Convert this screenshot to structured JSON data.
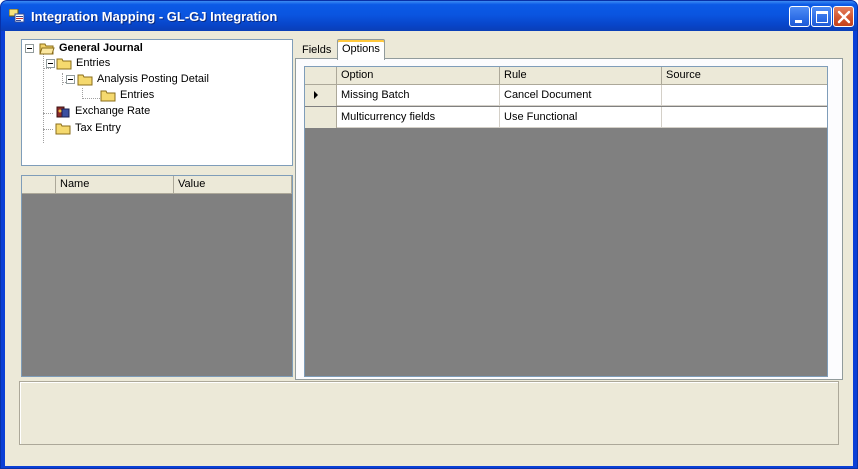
{
  "window": {
    "title": "Integration Mapping - GL-GJ Integration",
    "colors": {
      "titlebar": "#0a55e0",
      "client": "#ece9d8",
      "grid_empty": "#808080"
    }
  },
  "tree": {
    "items": [
      {
        "label": "General Journal",
        "icon": "folder-open-icon",
        "bold": true
      },
      {
        "label": "Entries",
        "icon": "folder-icon"
      },
      {
        "label": "Analysis Posting Detail",
        "icon": "folder-icon"
      },
      {
        "label": "Entries",
        "icon": "folder-icon"
      },
      {
        "label": "Exchange Rate",
        "icon": "exchange-rate-icon"
      },
      {
        "label": "Tax Entry",
        "icon": "folder-icon"
      }
    ]
  },
  "properties": {
    "columns": [
      "Name",
      "Value"
    ]
  },
  "tabs": [
    {
      "label": "Fields",
      "active": false
    },
    {
      "label": "Options",
      "active": true
    }
  ],
  "options_grid": {
    "columns": [
      "Option",
      "Rule",
      "Source"
    ],
    "rows": [
      {
        "option": "Missing Batch",
        "rule": "Cancel Document",
        "source": "",
        "current": true
      },
      {
        "option": "Multicurrency fields",
        "rule": "Use Functional",
        "source": "",
        "current": false
      }
    ]
  }
}
